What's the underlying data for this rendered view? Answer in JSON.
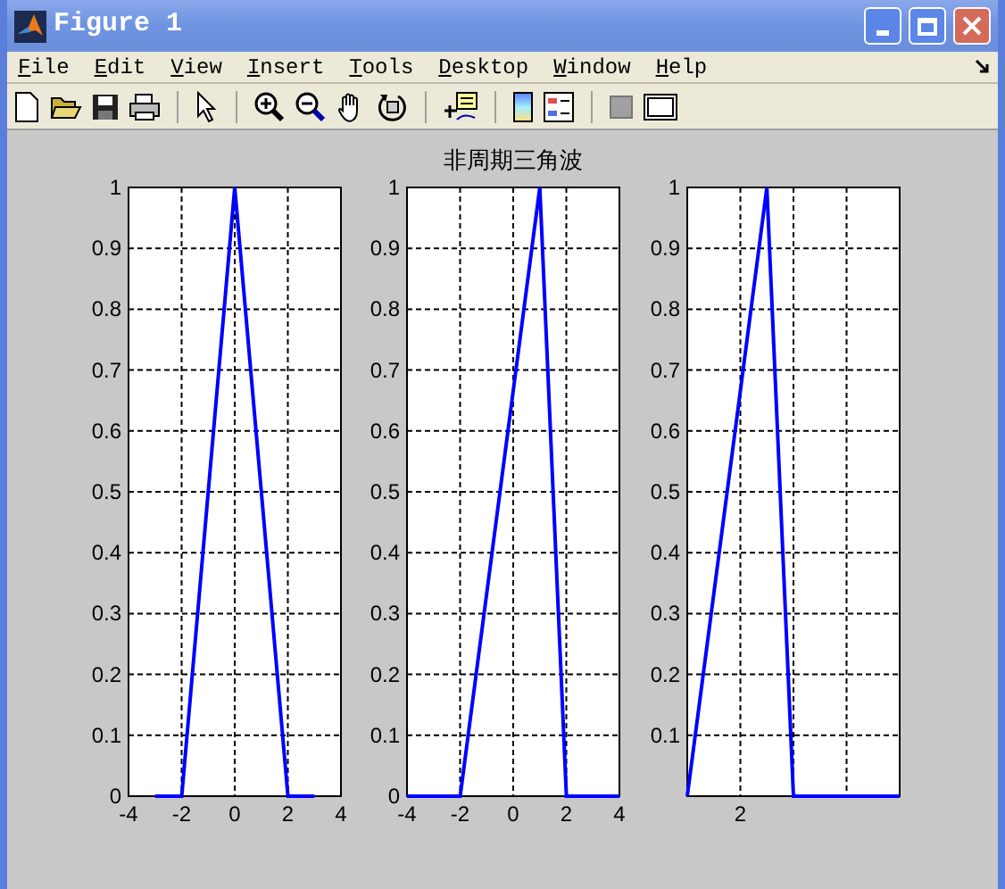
{
  "window": {
    "title": "Figure 1"
  },
  "menu": [
    "File",
    "Edit",
    "View",
    "Insert",
    "Tools",
    "Desktop",
    "Window",
    "Help"
  ],
  "axes": [
    {
      "chart_data": {
        "type": "line",
        "grid": true,
        "x": [
          -3,
          -2,
          0,
          2,
          3
        ],
        "series": [
          {
            "color": "#0000ff",
            "values": [
              0,
              0,
              1,
              0,
              0
            ]
          }
        ],
        "xlim": [
          -4,
          4
        ],
        "ylim": [
          0,
          1
        ],
        "xticks": [
          -4,
          -2,
          0,
          2,
          4
        ],
        "yticks": [
          0,
          0.1,
          0.2,
          0.3,
          0.4,
          0.5,
          0.6,
          0.7,
          0.8,
          0.9,
          1
        ]
      }
    },
    {
      "chart_data": {
        "type": "line",
        "grid": true,
        "title": "非周期三角波",
        "x": [
          -4,
          -2,
          1,
          2,
          4
        ],
        "series": [
          {
            "color": "#0000ff",
            "values": [
              0,
              0,
              1,
              0,
              0
            ]
          }
        ],
        "xlim": [
          -4,
          4
        ],
        "ylim": [
          0,
          1
        ],
        "xticks": [
          -4,
          -2,
          0,
          2,
          4
        ],
        "yticks": [
          0,
          0.1,
          0.2,
          0.3,
          0.4,
          0.5,
          0.6,
          0.7,
          0.8,
          0.9,
          1
        ]
      }
    },
    {
      "chart_data": {
        "type": "line",
        "grid": true,
        "series": [
          {
            "color": "#0000ff",
            "values": [
              0,
              0.333,
              0.667,
              1,
              0,
              0,
              0,
              0,
              0
            ]
          }
        ],
        "ylim": [
          0,
          1
        ],
        "yticks": [
          0.1,
          0.2,
          0.3,
          0.4,
          0.5,
          0.6,
          0.7,
          0.8,
          0.9,
          1
        ],
        "annotations": [
          "2"
        ]
      }
    }
  ]
}
